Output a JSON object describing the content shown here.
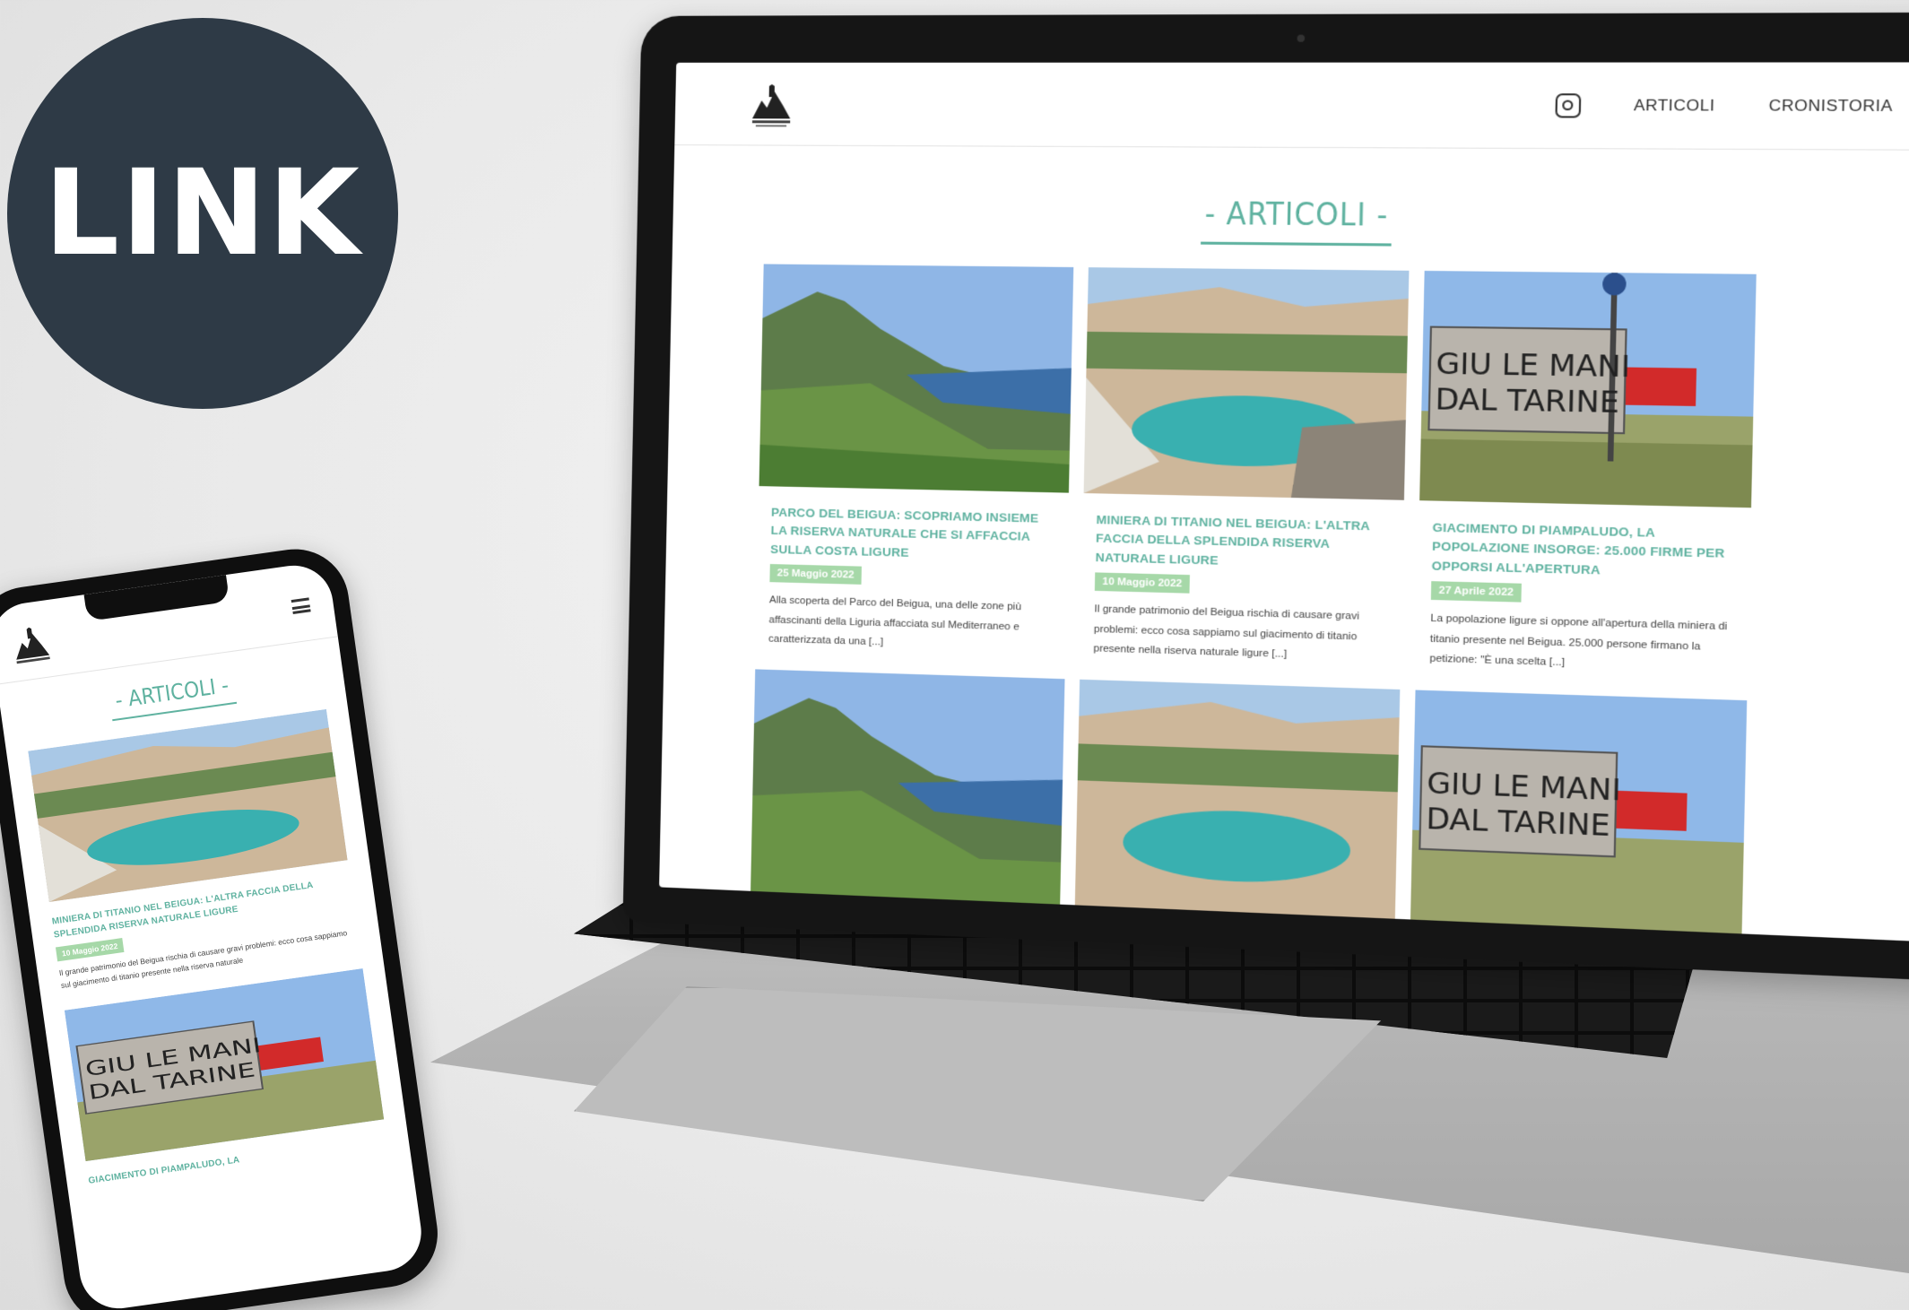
{
  "badge": {
    "label": "LINK"
  },
  "site": {
    "nav": [
      {
        "label": "ARTICOLI"
      },
      {
        "label": "CRONISTORIA"
      }
    ],
    "heading": "- ARTICOLI -",
    "articles": [
      {
        "title": "PARCO DEL BEIGUA: SCOPRIAMO INSIEME LA RISERVA NATURALE CHE SI AFFACCIA SULLA COSTA LIGURE",
        "date": "25 Maggio 2022",
        "excerpt": "Alla scoperta del Parco del Beigua, una delle zone più affascinanti della Liguria affacciata sul Mediterraneo e caratterizzata da una [...]"
      },
      {
        "title": "MINIERA DI TITANIO NEL BEIGUA: L'ALTRA FACCIA DELLA SPLENDIDA RISERVA NATURALE LIGURE",
        "date": "10 Maggio 2022",
        "excerpt": "Il grande patrimonio del Beigua rischia di causare gravi problemi: ecco cosa sappiamo sul giacimento di titanio presente nella riserva naturale ligure [...]"
      },
      {
        "title": "GIACIMENTO DI PIAMPALUDO, LA POPOLAZIONE INSORGE: 25.000 FIRME PER OPPORSI ALL'APERTURA",
        "date": "27 Aprile 2022",
        "excerpt": "La popolazione ligure si oppone all'apertura della miniera di titanio presente nel Beigua. 25.000 persone firmano la petizione: \"È una scelta [...]"
      }
    ],
    "sign_text": [
      "GIU LE MANI",
      "DAL TARINE"
    ]
  },
  "phone": {
    "heading": "- ARTICOLI -",
    "article": {
      "title": "MINIERA DI TITANIO NEL BEIGUA: L'ALTRA FACCIA DELLA SPLENDIDA RISERVA NATURALE LIGURE",
      "date": "10 Maggio 2022",
      "excerpt": "Il grande patrimonio del Beigua rischia di causare gravi problemi: ecco cosa sappiamo sul giacimento di titanio presente nella riserva naturale"
    },
    "next_title": "GIACIMENTO DI PIAMPALUDO, LA"
  },
  "colors": {
    "accent": "#5fb2a0",
    "date_badge": "#a6d8a8",
    "badge_bg": "#2e3a46"
  }
}
